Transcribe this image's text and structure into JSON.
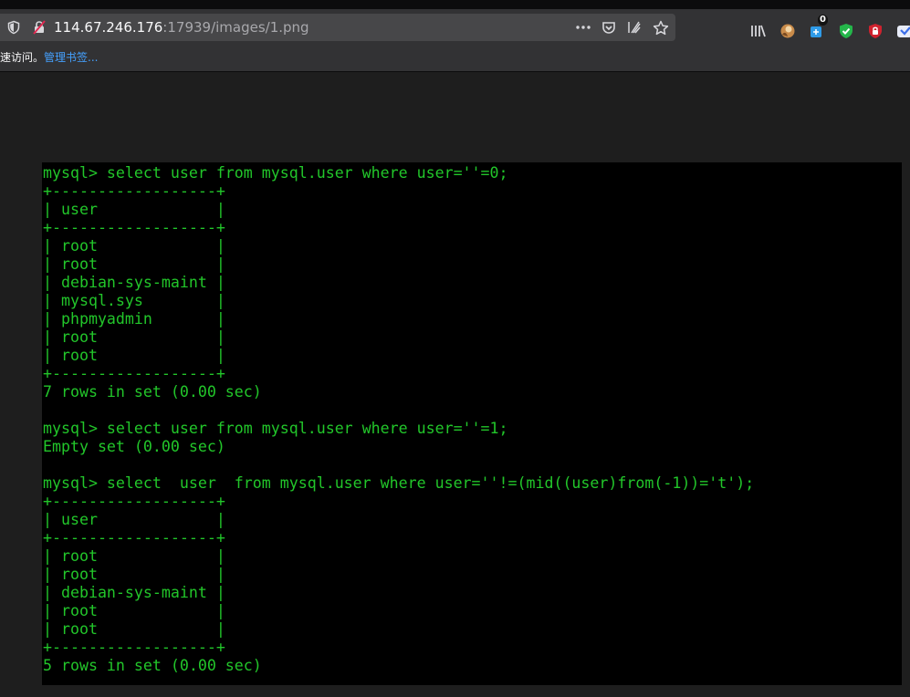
{
  "browser": {
    "url_host": "114.67.246.176",
    "url_rest": ":17939/images/1.png",
    "addon_badge": "0",
    "colors": {
      "toolbar": "#323234",
      "urlbar": "#474749",
      "page_bg": "#1e1e1e"
    },
    "icons": [
      "shield-icon",
      "insecure-lock-icon",
      "page-actions-icon",
      "pocket-icon",
      "reader-icon",
      "star-icon",
      "library-icon",
      "addon-avatar-icon",
      "addon-badge-icon",
      "adblock-shield-icon",
      "ublock-icon",
      "extension-icon"
    ]
  },
  "bookmarks": {
    "prefix": "速访问。",
    "manage": "管理书签..."
  },
  "terminal": {
    "text_color": "#22c62a",
    "background": "#000000",
    "lines": [
      "mysql> select user from mysql.user where user=''=0;",
      "+------------------+",
      "| user             |",
      "+------------------+",
      "| root             |",
      "| root             |",
      "| debian-sys-maint |",
      "| mysql.sys        |",
      "| phpmyadmin       |",
      "| root             |",
      "| root             |",
      "+------------------+",
      "7 rows in set (0.00 sec)",
      "",
      "mysql> select user from mysql.user where user=''=1;",
      "Empty set (0.00 sec)",
      "",
      "mysql> select  user  from mysql.user where user=''!=(mid((user)from(-1))='t');",
      "+------------------+",
      "| user             |",
      "+------------------+",
      "| root             |",
      "| root             |",
      "| debian-sys-maint |",
      "| root             |",
      "| root             |",
      "+------------------+",
      "5 rows in set (0.00 sec)"
    ]
  }
}
